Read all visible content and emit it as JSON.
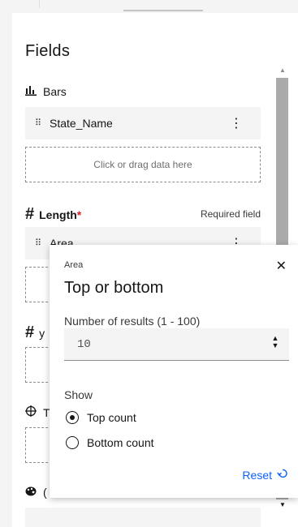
{
  "fields": {
    "title": "Fields",
    "bars": {
      "label": "Bars",
      "icon": "bar-chart-icon",
      "chip": "State_Name",
      "drop_hint": "Click or drag data here"
    },
    "length": {
      "label": "Length",
      "required_mark": "*",
      "required_text": "Required field",
      "icon": "hash-icon",
      "chip": "Area"
    },
    "third": {
      "label": "y",
      "icon": "hash-icon"
    },
    "fourth": {
      "label": "T",
      "icon": "crosshair-icon"
    },
    "fifth": {
      "label": "(",
      "icon": "palette-icon"
    }
  },
  "popover": {
    "overline": "Area",
    "title": "Top or bottom",
    "number_label": "Number of results (1 - 100)",
    "number_value": "10",
    "show_label": "Show",
    "options": [
      {
        "label": "Top count",
        "selected": true
      },
      {
        "label": "Bottom count",
        "selected": false
      }
    ],
    "reset_label": "Reset"
  },
  "colors": {
    "link": "#0f62fe",
    "panel_bg": "#ffffff",
    "chip_bg": "#f4f4f4"
  }
}
